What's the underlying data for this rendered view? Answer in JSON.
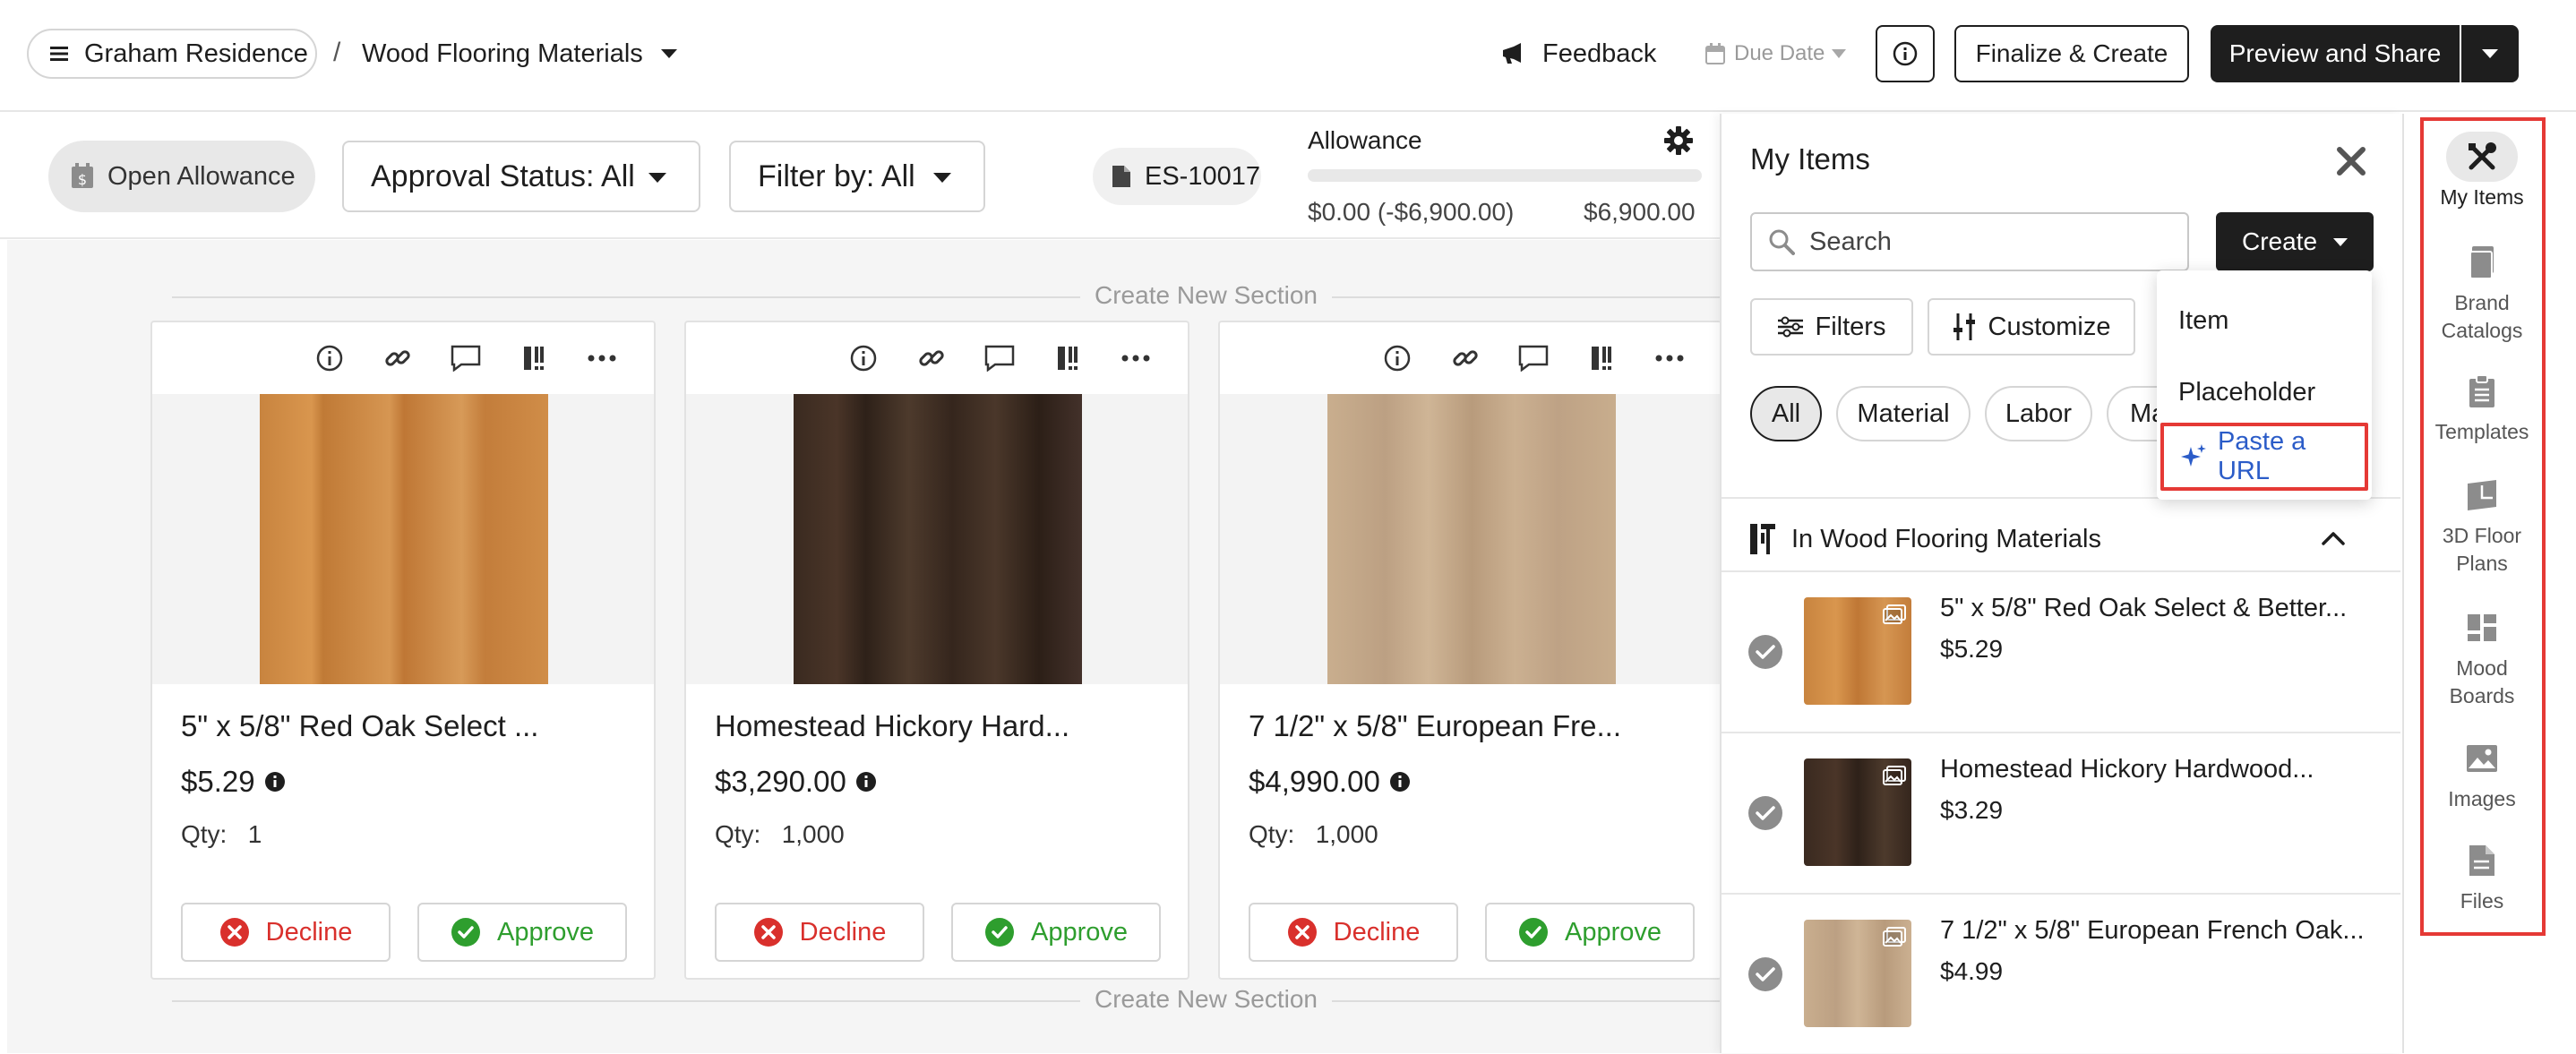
{
  "header": {
    "project": "Graham Residence",
    "separator": "/",
    "section": "Wood Flooring Materials",
    "feedback": "Feedback",
    "due_date": "Due Date",
    "finalize": "Finalize & Create",
    "preview_share": "Preview and Share"
  },
  "filterbar": {
    "open_allowance": "Open Allowance",
    "approval_status": "Approval Status: All",
    "filter_by": "Filter by: All",
    "estimate_id": "ES-10017",
    "allowance_label": "Allowance",
    "allowance_spent": "$0.00 (-$6,900.00)",
    "allowance_total": "$6,900.00",
    "allowance_progress": 0
  },
  "main": {
    "create_section": "Create New Section",
    "cards": [
      {
        "title": "5\" x 5/8\" Red Oak Select ...",
        "price": "$5.29",
        "qty_label": "Qty:",
        "qty": "1",
        "decline": "Decline",
        "approve": "Approve"
      },
      {
        "title": "Homestead Hickory Hard...",
        "price": "$3,290.00",
        "qty_label": "Qty:",
        "qty": "1,000",
        "decline": "Decline",
        "approve": "Approve"
      },
      {
        "title": "7 1/2\" x 5/8\" European Fre...",
        "price": "$4,990.00",
        "qty_label": "Qty:",
        "qty": "1,000",
        "decline": "Decline",
        "approve": "Approve"
      }
    ]
  },
  "panel": {
    "title": "My Items",
    "search_placeholder": "Search",
    "create": "Create",
    "filters": "Filters",
    "customize": "Customize",
    "chips": [
      "All",
      "Material",
      "Labor",
      "Ma"
    ],
    "group_title": "In Wood Flooring Materials",
    "items": [
      {
        "title": "5\" x 5/8\" Red Oak Select & Better...",
        "price": "$5.29"
      },
      {
        "title": "Homestead Hickory Hardwood...",
        "price": "$3.29"
      },
      {
        "title": "7 1/2\" x 5/8\" European French Oak...",
        "price": "$4.99"
      }
    ]
  },
  "create_menu": {
    "items": [
      "Item",
      "Placeholder",
      "Paste a URL"
    ]
  },
  "rail": {
    "items": [
      {
        "label": "My Items"
      },
      {
        "label": "Brand Catalogs"
      },
      {
        "label": "Templates"
      },
      {
        "label": "3D Floor Plans"
      },
      {
        "label": "Mood Boards"
      },
      {
        "label": "Images"
      },
      {
        "label": "Files"
      }
    ]
  },
  "colors": {
    "decline": "#d9302c",
    "approve": "#2e9e2e",
    "highlight": "#e53935",
    "link": "#2b5cc8"
  }
}
